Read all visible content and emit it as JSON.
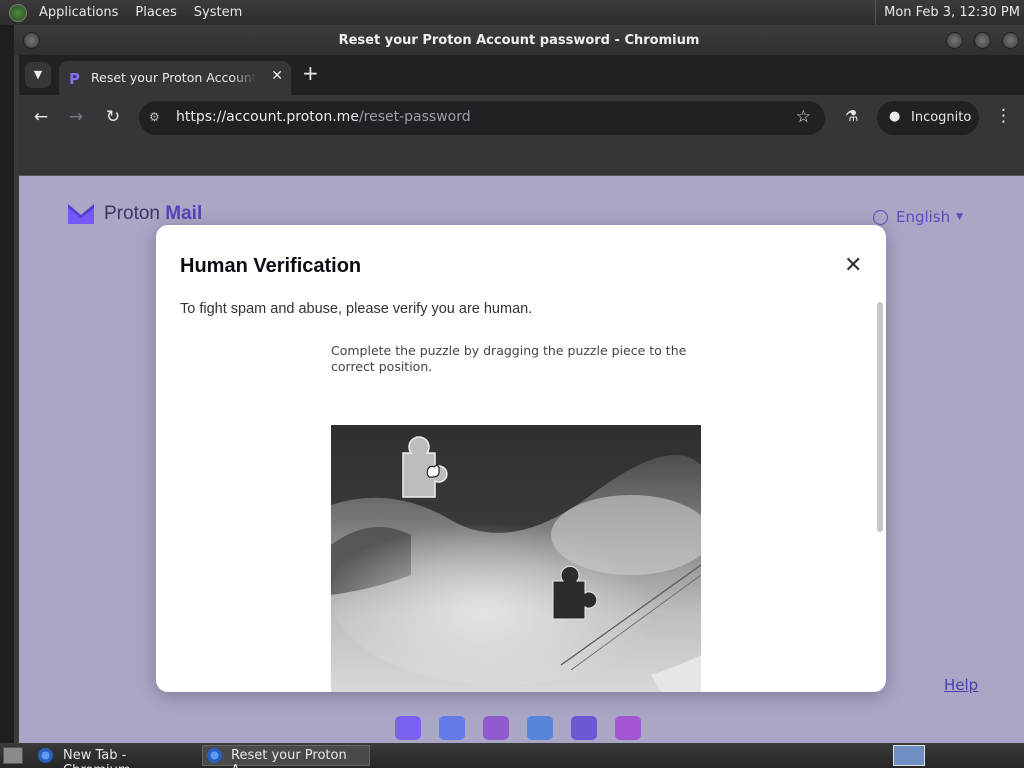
{
  "panel": {
    "menus": [
      "Applications",
      "Places",
      "System"
    ],
    "clock": "Mon Feb  3, 12:30 PM"
  },
  "window": {
    "title": "Reset your Proton Account password - Chromium"
  },
  "browser": {
    "tab_title": "Reset your Proton Account password",
    "new_tab_symbol": "+",
    "url_host": "https://account.proton.me",
    "url_path": "/reset-password",
    "incognito_label": "Incognito"
  },
  "page": {
    "brand_prefix": "Proton",
    "brand_suffix": "Mail",
    "language": "English",
    "help_link": "Help"
  },
  "modal": {
    "title": "Human Verification",
    "subtitle": "To fight spam and abuse, please verify you are human.",
    "instruction": "Complete the puzzle by dragging the puzzle piece to the correct position."
  },
  "taskbar": {
    "items": [
      {
        "label": "New Tab - Chromium",
        "active": false
      },
      {
        "label": "Reset your Proton A...",
        "active": true
      }
    ]
  },
  "colors": {
    "accent": "#6d4aff",
    "page_bg": "#a9a6c6",
    "browser_dark": "#202124",
    "browser_toolbar": "#35363a"
  }
}
